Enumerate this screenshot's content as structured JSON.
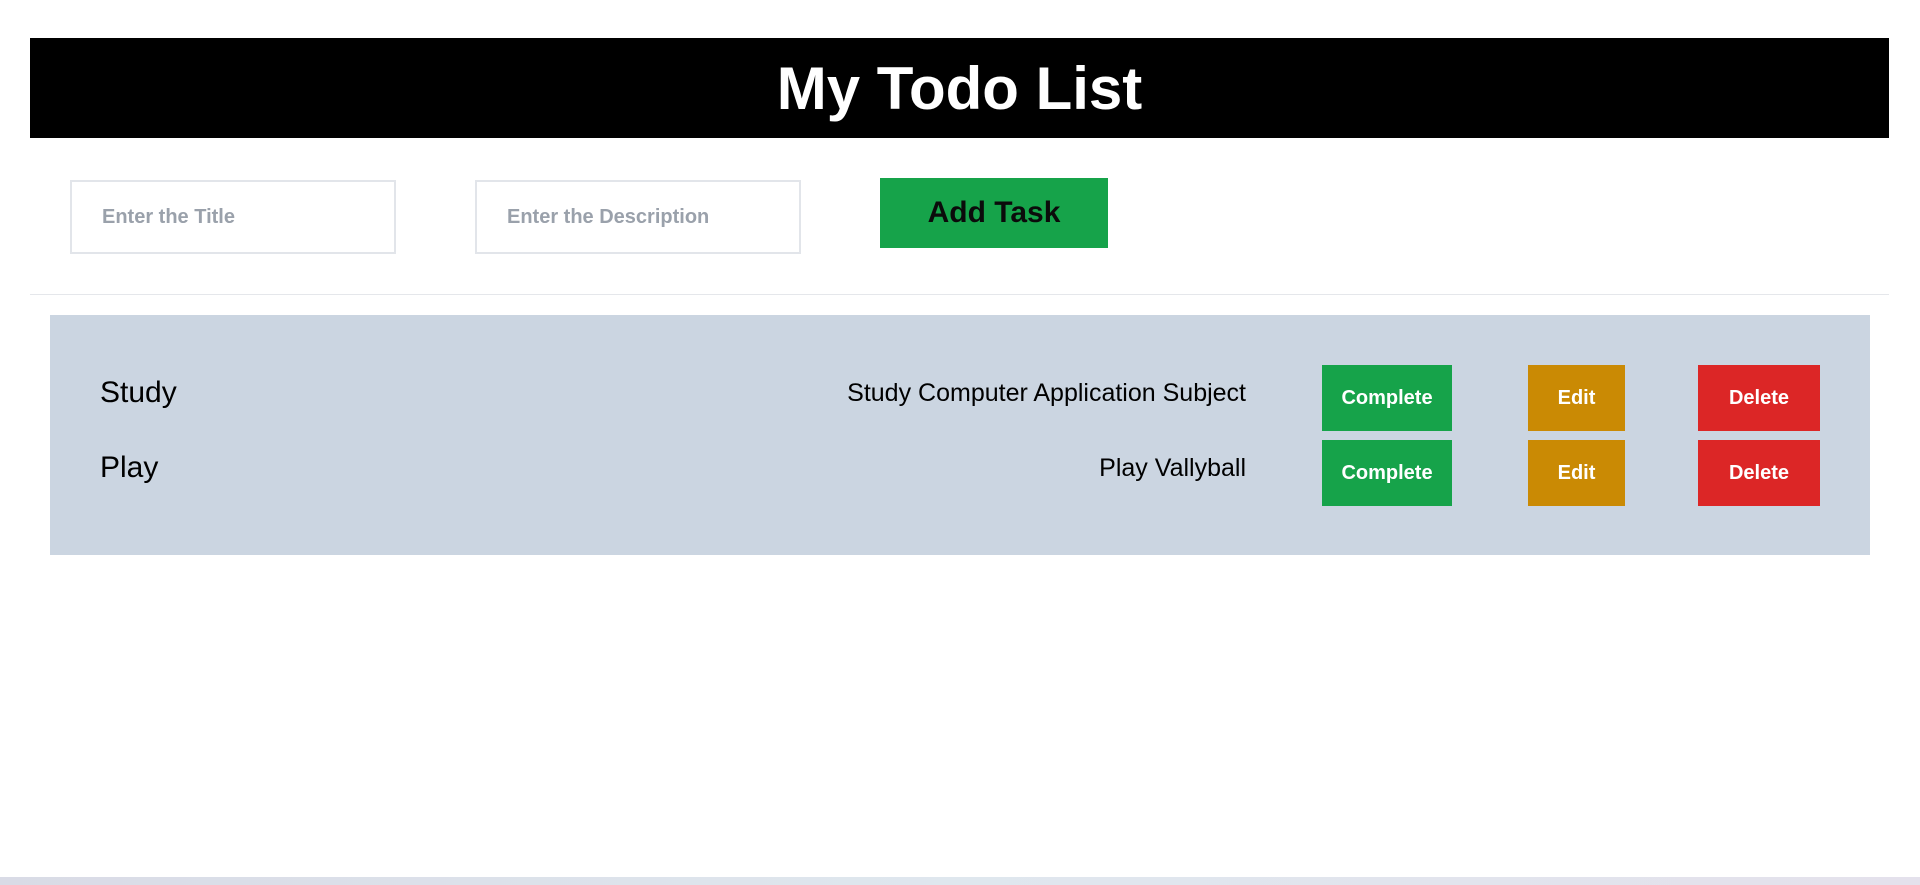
{
  "header": {
    "title": "My Todo List"
  },
  "form": {
    "title_placeholder": "Enter the Title",
    "title_value": "",
    "description_placeholder": "Enter the Description",
    "description_value": "",
    "add_label": "Add Task"
  },
  "tasks": [
    {
      "title": "Study",
      "description": "Study Computer Application Subject",
      "complete_label": "Complete",
      "edit_label": "Edit",
      "delete_label": "Delete"
    },
    {
      "title": "Play",
      "description": "Play Vallyball",
      "complete_label": "Complete",
      "edit_label": "Edit",
      "delete_label": "Delete"
    }
  ],
  "colors": {
    "header_bg": "#000000",
    "add_button": "#16a34a",
    "complete_button": "#16a34a",
    "edit_button": "#ca8a04",
    "delete_button": "#dc2626",
    "list_panel": "#cbd5e1"
  }
}
